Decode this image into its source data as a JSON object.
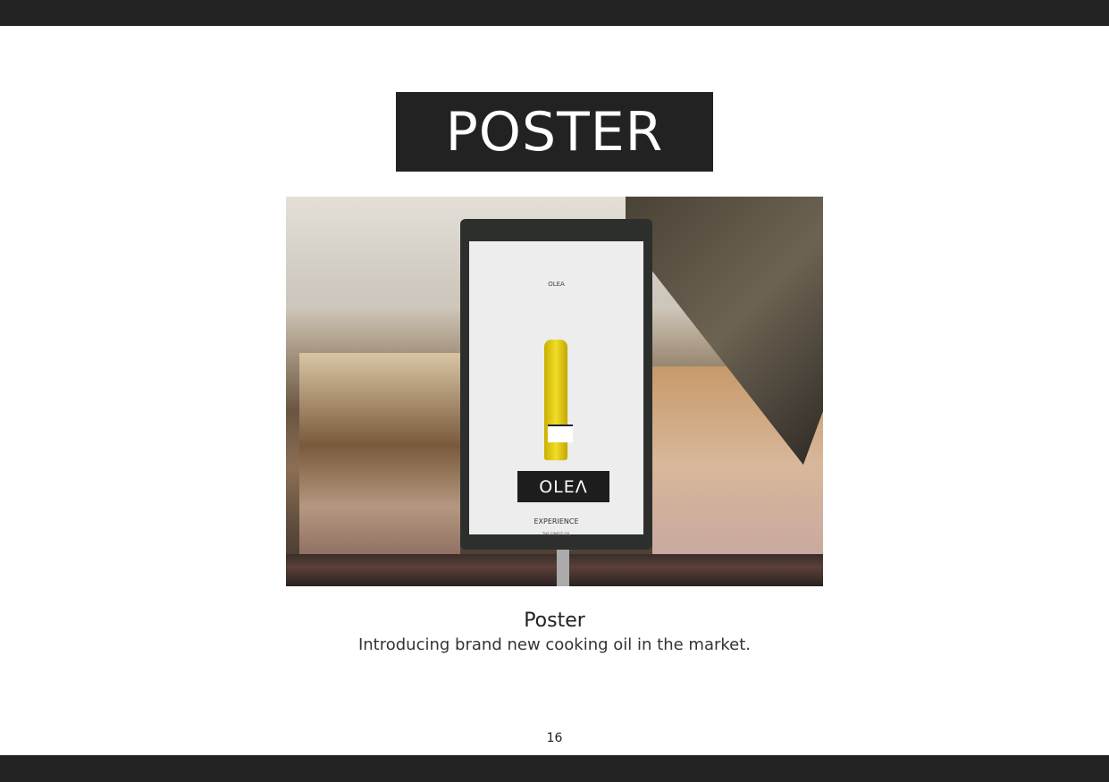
{
  "heading": "POSTER",
  "poster": {
    "logo_text": "OLEA",
    "brand": "OLEΛ",
    "tagline_main": "EXPERIENCE",
    "tagline_sub": "THE FINEST OIL"
  },
  "caption": {
    "title": "Poster",
    "description": "Introducing brand new cooking oil in the market."
  },
  "page_number": "16"
}
